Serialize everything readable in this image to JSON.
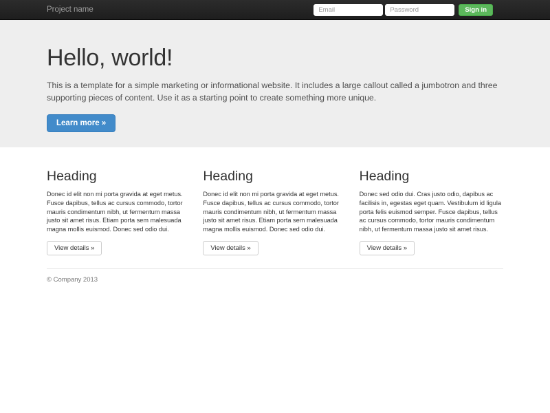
{
  "navbar": {
    "brand": "Project name",
    "email_placeholder": "Email",
    "password_placeholder": "Password",
    "signin_label": "Sign in"
  },
  "jumbotron": {
    "title": "Hello, world!",
    "description": "This is a template for a simple marketing or informational website. It includes a large callout called a jumbotron and three supporting pieces of content. Use it as a starting point to create something more unique.",
    "cta_label": "Learn more »"
  },
  "columns": [
    {
      "heading": "Heading",
      "text": "Donec id elit non mi porta gravida at eget metus. Fusce dapibus, tellus ac cursus commodo, tortor mauris condimentum nibh, ut fermentum massa justo sit amet risus. Etiam porta sem malesuada magna mollis euismod. Donec sed odio dui.",
      "button_label": "View details »"
    },
    {
      "heading": "Heading",
      "text": "Donec id elit non mi porta gravida at eget metus. Fusce dapibus, tellus ac cursus commodo, tortor mauris condimentum nibh, ut fermentum massa justo sit amet risus. Etiam porta sem malesuada magna mollis euismod. Donec sed odio dui.",
      "button_label": "View details »"
    },
    {
      "heading": "Heading",
      "text": "Donec sed odio dui. Cras justo odio, dapibus ac facilisis in, egestas eget quam. Vestibulum id ligula porta felis euismod semper. Fusce dapibus, tellus ac cursus commodo, tortor mauris condimentum nibh, ut fermentum massa justo sit amet risus.",
      "button_label": "View details »"
    }
  ],
  "footer": {
    "copyright": "© Company 2013"
  },
  "colors": {
    "primary": "#428bca",
    "success": "#5cb85c",
    "navbar_bg": "#222222",
    "jumbotron_bg": "#eeeeee"
  }
}
